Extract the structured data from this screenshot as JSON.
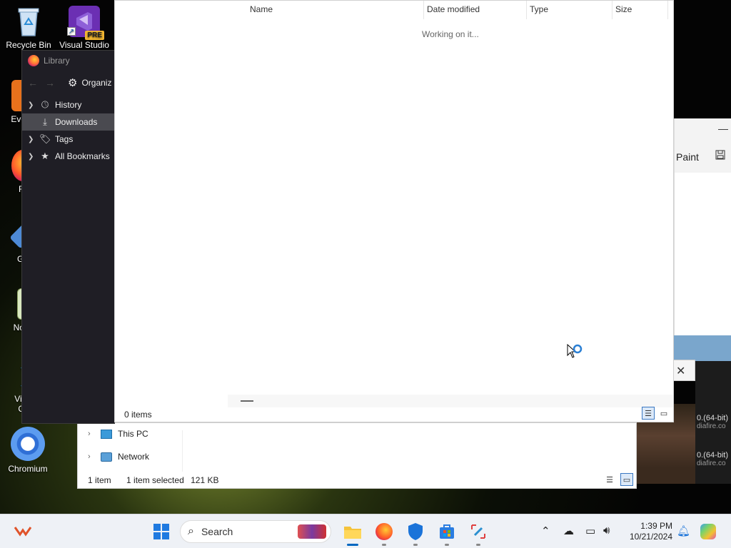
{
  "desktop": {
    "icons": [
      {
        "label": "Recycle Bin",
        "icon": "recycle-bin-icon"
      },
      {
        "label": "Visual Studio",
        "icon": "visual-studio-icon",
        "badge": "PRE"
      },
      {
        "label": "Eve",
        "icon": "everything-icon"
      },
      {
        "label": "Fi",
        "icon": "firefox-icon"
      },
      {
        "label": "Gi",
        "icon": "git-icon"
      },
      {
        "label": "Note",
        "icon": "notepad-icon"
      },
      {
        "label": "Visua",
        "icon": "vscode-icon",
        "label2": "C"
      },
      {
        "label": "Chromium",
        "icon": "chromium-icon"
      }
    ]
  },
  "paint": {
    "title": "Paint",
    "minimize": "—",
    "save_icon": "save-icon"
  },
  "dialog": {
    "close": "✕"
  },
  "media": {
    "rows": [
      {
        "title": "0.(64-bit)",
        "sub": "diafire.co"
      },
      {
        "title": "0.(64-bit)",
        "sub": "diafire.co"
      }
    ]
  },
  "explorer": {
    "nav": [
      {
        "label": "This PC",
        "icon": "this-pc-icon"
      },
      {
        "label": "Network",
        "icon": "network-icon"
      }
    ],
    "status": {
      "count": "1 item",
      "selected": "1 item selected",
      "size": "121 KB"
    }
  },
  "library": {
    "title": "Library",
    "organize": "Organiz",
    "tree": [
      {
        "label": "History",
        "icon": "clock-icon",
        "expandable": true,
        "selected": false
      },
      {
        "label": "Downloads",
        "icon": "download-icon",
        "expandable": false,
        "selected": true
      },
      {
        "label": "Tags",
        "icon": "tag-icon",
        "expandable": true,
        "selected": false
      },
      {
        "label": "All Bookmarks",
        "icon": "star-icon",
        "expandable": true,
        "selected": false
      }
    ]
  },
  "downloads": {
    "columns": [
      "Name",
      "Date modified",
      "Type",
      "Size"
    ],
    "working": "Working on it...",
    "items_count": "0 items"
  },
  "taskbar": {
    "search_placeholder": "Search",
    "time": "1:39 PM",
    "date": "10/21/2024"
  }
}
